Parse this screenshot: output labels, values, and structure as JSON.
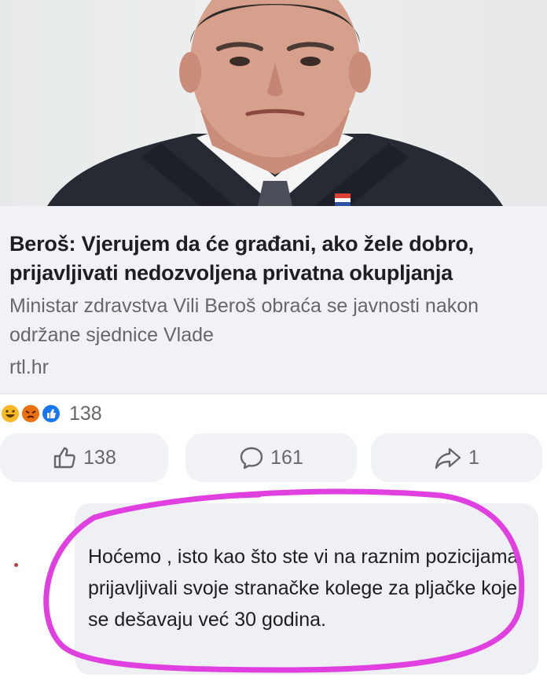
{
  "article": {
    "headline": "Beroš: Vjerujem da će građani, ako žele dobro, prijavljivati nedozvoljena privatna okupljanja",
    "description": "Ministar zdravstva Vili Beroš obraća se javnosti nakon održane sjednice Vlade",
    "domain": "rtl.hr"
  },
  "reactions": {
    "icons": [
      "haha-icon",
      "angry-icon",
      "like-icon"
    ],
    "count": "138"
  },
  "actions": {
    "like_count": "138",
    "comment_count": "161",
    "share_count": "1"
  },
  "comment": {
    "text": "Hoćemo , isto kao što ste vi na raznim pozicijama prijavljivali svoje stranačke kolege za pljačke koje se dešavaju već 30 godina."
  },
  "colors": {
    "annotation_circle": "#e040e0",
    "haha": "#f7b928",
    "angry": "#e9710f",
    "like": "#1877f2"
  }
}
